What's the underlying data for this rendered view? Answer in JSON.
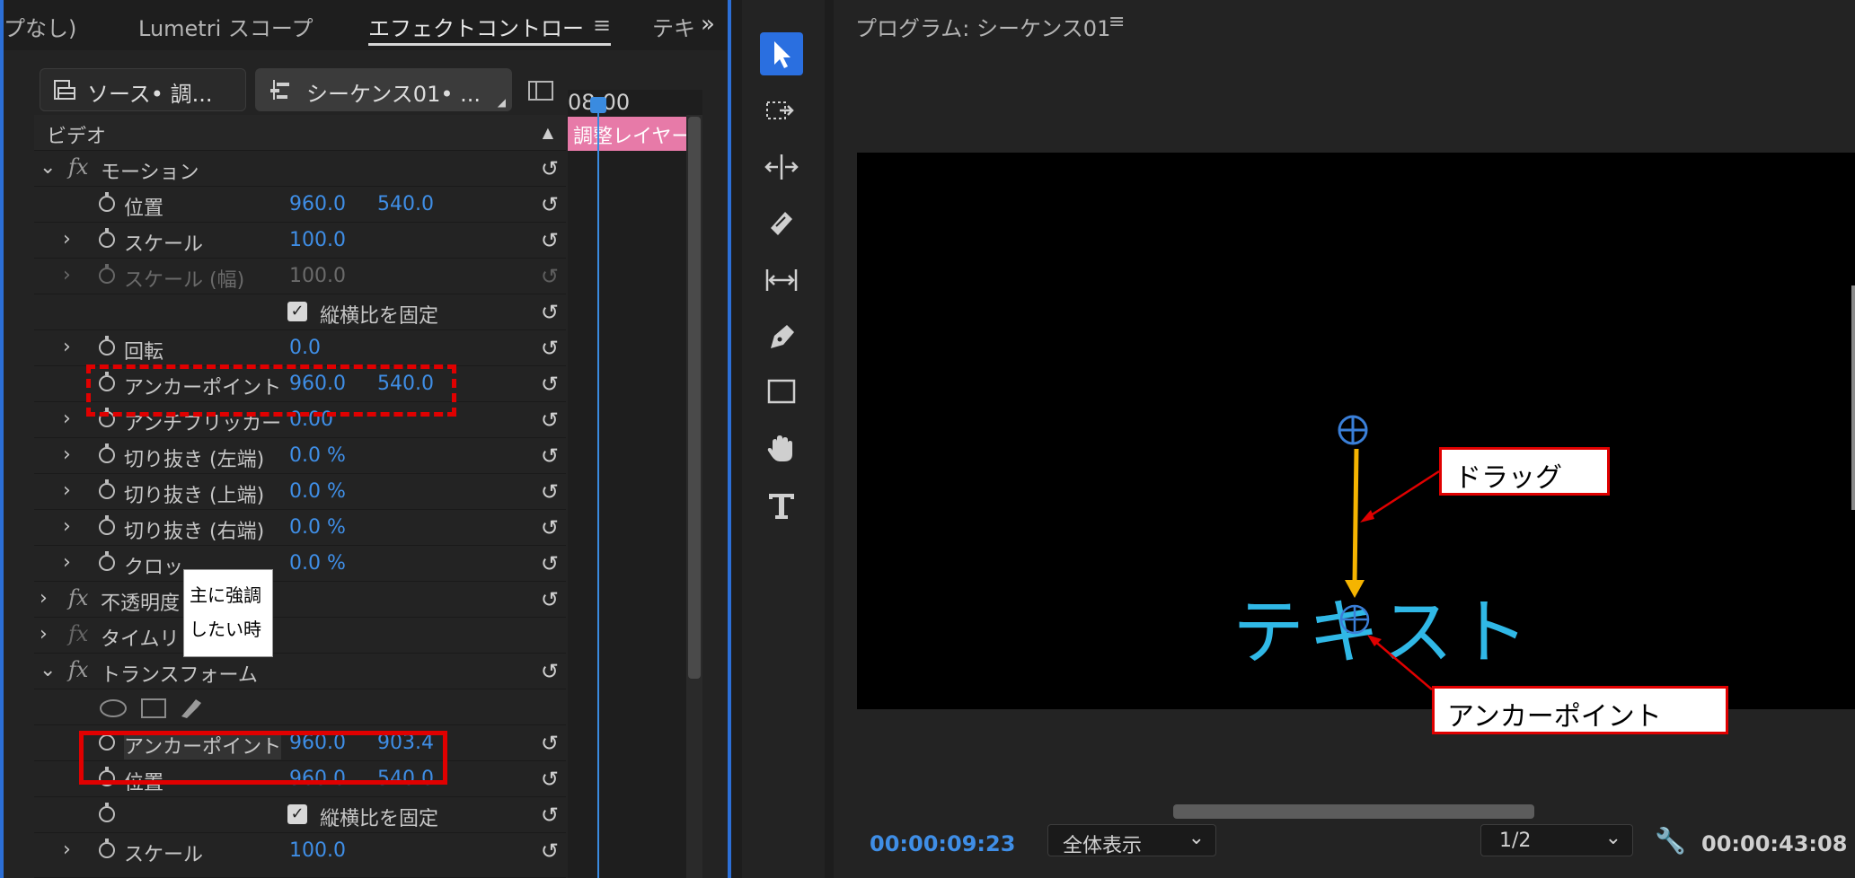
{
  "left_panel": {
    "tabs": [
      "プなし)",
      "Lumetri スコープ",
      "エフェクトコントロー",
      "テキ"
    ],
    "tab_menu_icon": "hamburger-icon",
    "overflow_icon": "double-chevron-icon",
    "clip_buttons": {
      "source_label": "ソース• 調...",
      "sequence_label": "シーケンス01• ..."
    },
    "timeline": {
      "time": "08:00",
      "clip_label": "調整レイヤー"
    },
    "section_video": "ビデオ",
    "motion": {
      "title": "モーション",
      "position": {
        "label": "位置",
        "x": "960.0",
        "y": "540.0"
      },
      "scale": {
        "label": "スケール",
        "value": "100.0"
      },
      "scale_width": {
        "label": "スケール (幅)",
        "value": "100.0"
      },
      "uniform_scale": "縦横比を固定",
      "rotation": {
        "label": "回転",
        "value": "0.0"
      },
      "anchor": {
        "label": "アンカーポイント",
        "x": "960.0",
        "y": "540.0"
      },
      "antiflicker": {
        "label": "アンチフリッカー",
        "value": "0.00"
      },
      "crop_left": {
        "label": "切り抜き (左端)",
        "value": "0.0 %"
      },
      "crop_top": {
        "label": "切り抜き (上端)",
        "value": "0.0 %"
      },
      "crop_right": {
        "label": "切り抜き (右端)",
        "value": "0.0 %"
      },
      "crop_bottom": {
        "label": "クロッ",
        "value": "0.0 %"
      }
    },
    "opacity": {
      "title": "不透明度"
    },
    "time_remap": {
      "title": "タイムリ"
    },
    "transform": {
      "title": "トランスフォーム",
      "anchor": {
        "label": "アンカーポイント",
        "x": "960.0",
        "y": "903.4"
      },
      "position": {
        "label": "位置",
        "x": "960.0",
        "y": "540.0"
      },
      "uniform_scale": "縦横比を固定",
      "scale": {
        "label": "スケール",
        "value": "100.0"
      }
    },
    "tooltip_line1": "主に強調",
    "tooltip_line2": "したい時"
  },
  "program": {
    "title": "プログラム: シーケンス01",
    "video_text": "テキスト",
    "timecode_current": "00:00:09:23",
    "fit_option": "全体表示",
    "resolution_option": "1/2",
    "timecode_duration": "00:00:43:08",
    "callout_drag": "ドラッグ",
    "callout_anchor": "アンカーポイント"
  },
  "colors": {
    "accent_blue": "#3f8ee6",
    "annotation_red": "#e00000",
    "arrow_orange": "#f5b400",
    "clip_pink": "#e77aa8",
    "video_text": "#30b8e6"
  }
}
